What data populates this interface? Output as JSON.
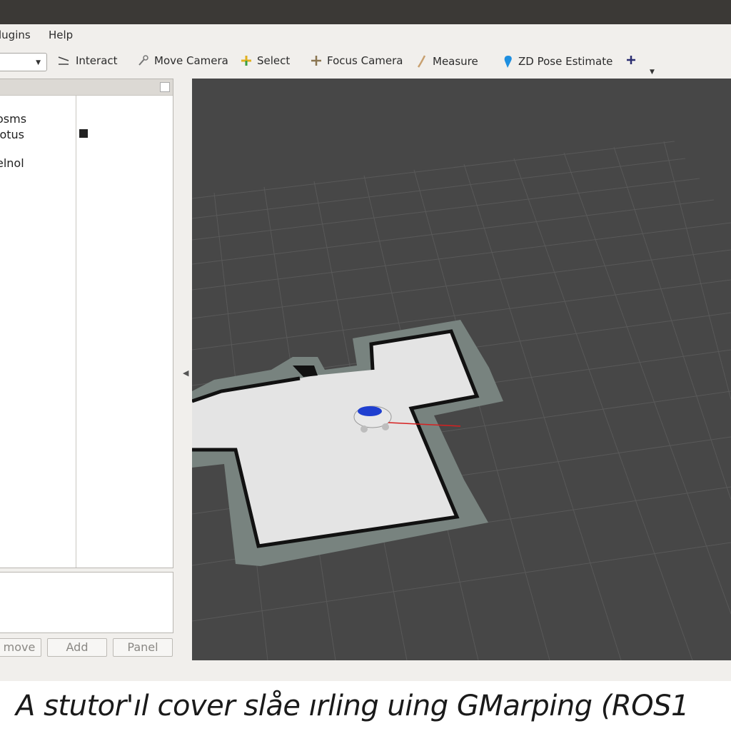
{
  "menubar": {
    "items": [
      "lugins",
      "Help"
    ]
  },
  "toolbar": {
    "tools": [
      {
        "label": "Interact",
        "icon": "interact-icon"
      },
      {
        "label": "Move Camera",
        "icon": "move-camera-icon"
      },
      {
        "label": "Select",
        "icon": "select-icon"
      },
      {
        "label": "Focus Camera",
        "icon": "focus-camera-icon"
      },
      {
        "label": "Measure",
        "icon": "measure-icon"
      },
      {
        "label": "ZD Pose Estimate",
        "icon": "pose-estimate-icon"
      }
    ],
    "add_icon": "plus-icon"
  },
  "displays": {
    "items": [
      "osms",
      "lotus",
      "elnol"
    ]
  },
  "buttons": {
    "remove": "move",
    "add": "Add",
    "panel": "Panel"
  },
  "caption": "A stutor'ıl cover slåe ırling uing GMarping (ROS1",
  "colors": {
    "viewport_bg": "#474747",
    "grid": "#5a5a5a",
    "map_free": "#e6e6e6",
    "map_wall": "#111111",
    "map_unknown_border": "#78837f",
    "robot_accent": "#1f3fd0",
    "heading_arrow": "#d62020"
  }
}
